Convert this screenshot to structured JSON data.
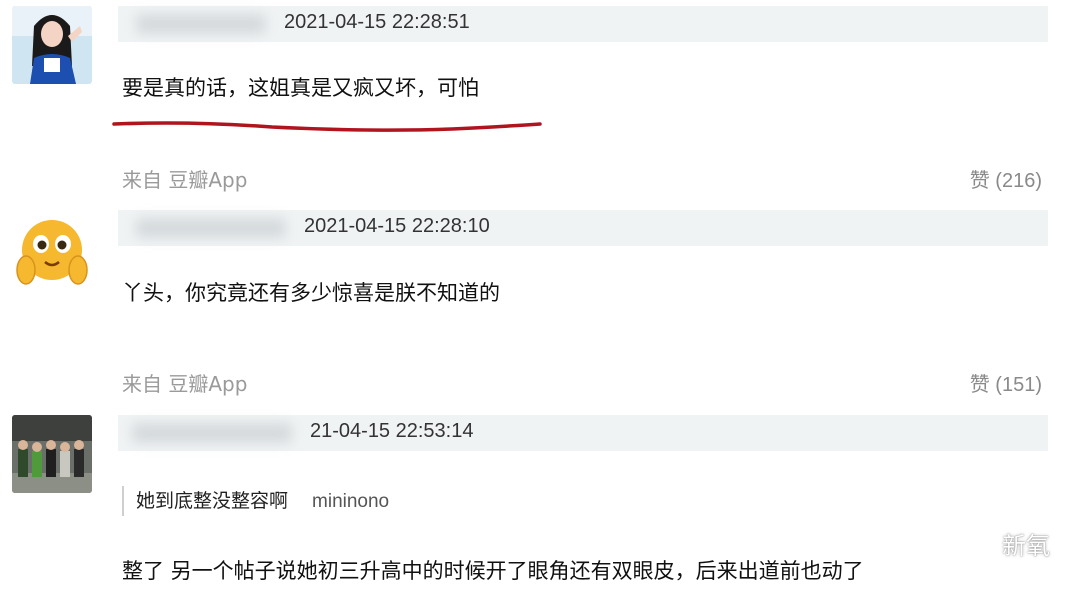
{
  "comments": [
    {
      "timestamp": "2021-04-15 22:28:51",
      "text": "要是真的话，这姐真是又疯又坏，可怕",
      "source": "来自 豆瓣App",
      "likes": "赞 (216)",
      "avatar": "woman-photo-avatar"
    },
    {
      "timestamp": "2021-04-15 22:28:10",
      "text": "丫头，你究竟还有多少惊喜是朕不知道的",
      "source": "来自 豆瓣App",
      "likes": "赞 (151)",
      "avatar": "emoji-avatar"
    },
    {
      "timestamp": "21-04-15 22:53:14",
      "quote": "她到底整没整容啊",
      "quote_user": "mininono",
      "text": "整了 另一个帖子说她初三升高中的时候开了眼角还有双眼皮，后来出道前也动了",
      "avatar": "group-photo-avatar"
    }
  ],
  "watermark": {
    "text": "新氧",
    "icon": "wechat-icon"
  },
  "colors": {
    "meta_bar": "#f0f3f4",
    "underline": "#b0141e",
    "source_gray": "#9a9a9a"
  }
}
